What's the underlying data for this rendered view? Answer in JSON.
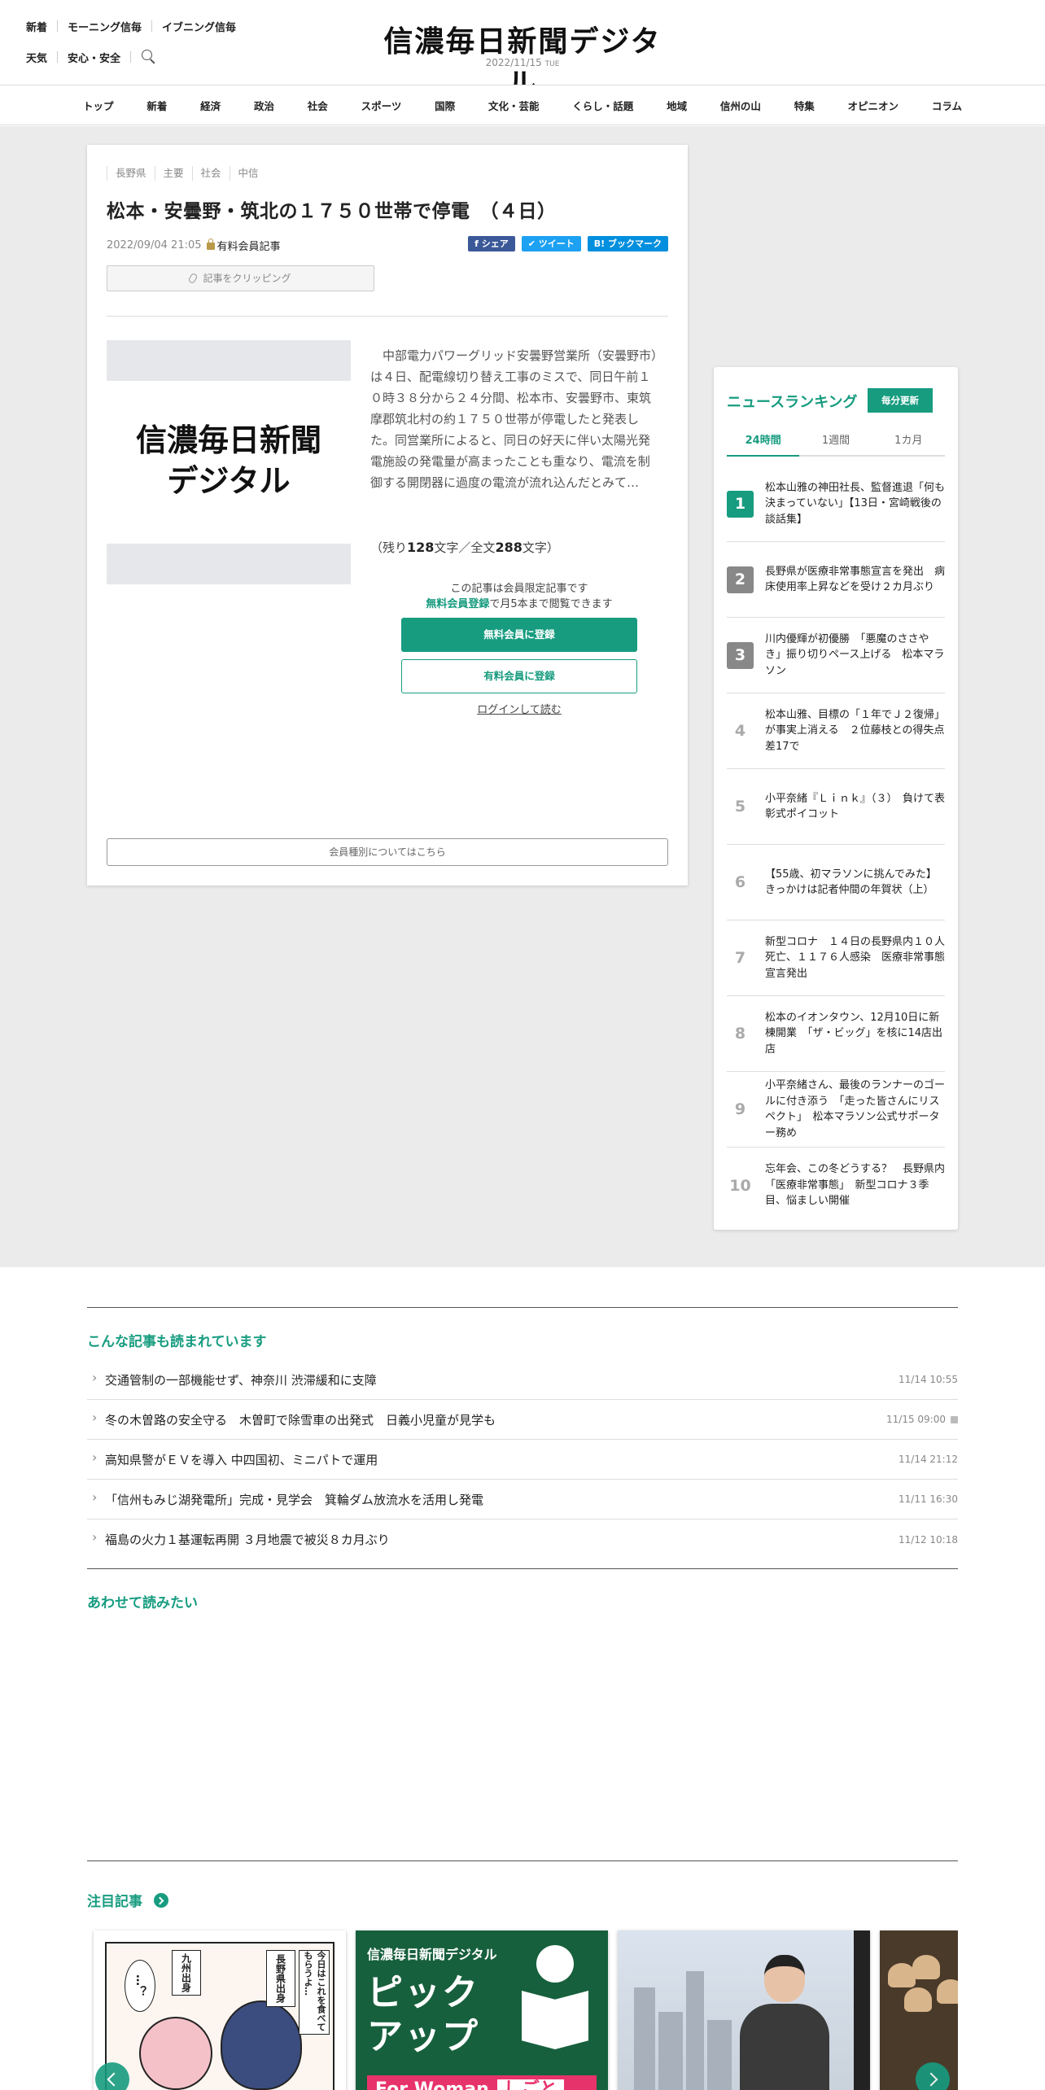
{
  "header": {
    "links_row1": [
      "新着",
      "モーニング信毎",
      "イブニング信毎"
    ],
    "links_row2": [
      "天気",
      "安心・安全"
    ],
    "logo": "信濃毎日新聞デジタル",
    "date": "2022/11/15",
    "weekday": "TUE"
  },
  "nav": [
    "トップ",
    "新着",
    "経済",
    "政治",
    "社会",
    "スポーツ",
    "国際",
    "文化・芸能",
    "くらし・話題",
    "地域",
    "信州の山",
    "特集",
    "オピニオン",
    "コラム"
  ],
  "article": {
    "tags": [
      "長野県",
      "主要",
      "社会",
      "中信"
    ],
    "title": "松本・安曇野・筑北の１７５０世帯で停電　（４日）",
    "datetime": "2022/09/04 21:05",
    "paid_label": "有料会員記事",
    "share": {
      "facebook": "シェア",
      "twitter": "ツイート",
      "hatena": "ブックマーク",
      "hatena_mark": "B!"
    },
    "clip": "記事をクリッピング",
    "image_logo_line1": "信濃毎日新聞",
    "image_logo_line2": "デジタル",
    "body": "中部電力パワーグリッド安曇野営業所（安曇野市）は４日、配電線切り替え工事のミスで、同日午前１０時３８分から２４分間、松本市、安曇野市、東筑摩郡筑北村の約１７５０世帯が停電したと発表した。同営業所によると、同日の好天に伴い太陽光発電施設の発電量が高まったことも重なり、電流を制御する開閉器に過度の電流が流れ込んだとみて…",
    "remain_prefix": "（残り",
    "remain_count": "128",
    "remain_mid": "文字／全文",
    "total_count": "288",
    "remain_suffix": "文字）",
    "member_notice": "この記事は会員限定記事です",
    "free_reg_link": "無料会員登録",
    "free_reg_suffix": "で月5本まで閲覧できます",
    "btn_free": "無料会員に登録",
    "btn_paid": "有料会員に登録",
    "login": "ログインして読む",
    "member_types": "会員種別についてはこちら"
  },
  "ranking": {
    "title": "ニュースランキング",
    "update": "毎分更新",
    "tabs": [
      "24時間",
      "1週間",
      "1カ月"
    ],
    "items": [
      {
        "num": "1",
        "text": "松本山雅の神田社長、監督進退「何も決まっていない」【13日・宮崎戦後の談話集】"
      },
      {
        "num": "2",
        "text": "長野県が医療非常事態宣言を発出　病床使用率上昇などを受け２カ月ぶり"
      },
      {
        "num": "3",
        "text": "川内優輝が初優勝　「悪魔のささやき」振り切りペース上げる　松本マラソン"
      },
      {
        "num": "4",
        "text": "松本山雅、目標の「１年でＪ２復帰」が事実上消える　２位藤枝との得失点差17で"
      },
      {
        "num": "5",
        "text": "小平奈緒『Ｌｉｎｋ』（３）　負けて表彰式ポイコット"
      },
      {
        "num": "6",
        "text": "【55歳、初マラソンに挑んでみた】　きっかけは記者仲間の年賀状（上）"
      },
      {
        "num": "7",
        "text": "新型コロナ　１４日の長野県内１０人死亡、１１７６人感染　医療非常事態宣言発出"
      },
      {
        "num": "8",
        "text": "松本のイオンタウン、12月10日に新棟開業　「ザ・ビッグ」を核に14店出店"
      },
      {
        "num": "9",
        "text": "小平奈緒さん、最後のランナーのゴールに付き添う　「走った皆さんにリスペクト」　松本マラソン公式サポーター務め"
      },
      {
        "num": "10",
        "text": "忘年会、この冬どうする？　長野県内「医療非常事態」　新型コロナ３季目、悩ましい開催"
      }
    ]
  },
  "related": {
    "title": "こんな記事も読まれています",
    "items": [
      {
        "text": "交通管制の一部機能せず、神奈川 渋滞緩和に支障",
        "date": "11/14 10:55",
        "locked": false
      },
      {
        "text": "冬の木曽路の安全守る　木曽町で除雪車の出発式　日義小児童が見学も",
        "date": "11/15 09:00",
        "locked": true
      },
      {
        "text": "高知県警がＥＶを導入 中四国初、ミニパトで運用",
        "date": "11/14 21:12",
        "locked": false
      },
      {
        "text": "「信州もみじ湖発電所」完成・見学会　箕輪ダム放流水を活用し発電",
        "date": "11/11 16:30",
        "locked": false
      },
      {
        "text": "福島の火力１基運転再開 ３月地震で被災８カ月ぶり",
        "date": "11/12 10:18",
        "locked": false
      }
    ]
  },
  "together": {
    "title": "あわせて読みたい"
  },
  "featured": {
    "title": "注目記事",
    "manga": {
      "bubble1": "九州出身",
      "bubble2": "長野県出身",
      "bubble3": "今日はこれを食べてもらうよ…",
      "bubble4": "…？"
    },
    "pickup": {
      "logo": "信濃毎日新聞デジタル",
      "line1": "ピック",
      "line2": "アップ",
      "band": "For Woman",
      "band_tag": "しごと"
    }
  },
  "colors": {
    "accent": "#179c80",
    "facebook": "#3b5998",
    "twitter": "#1da1f2",
    "hatena": "#008fde"
  }
}
